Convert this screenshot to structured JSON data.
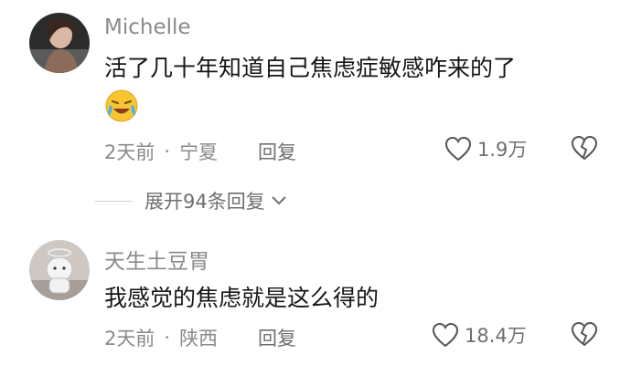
{
  "comments": [
    {
      "username": "Michelle",
      "text": "活了几十年知道自己焦虑症敏感咋来的了",
      "emoji": "crying-laughing-emoji",
      "time": "2天前",
      "location": "宁夏",
      "reply_label": "回复",
      "likes": "1.9万"
    },
    {
      "username": "天生土豆胃",
      "text": "我感觉的焦虑就是这么得的",
      "time": "2天前",
      "location": "陕西",
      "reply_label": "回复",
      "likes": "18.4万"
    }
  ],
  "thread": {
    "expand_label": "展开94条回复"
  },
  "colors": {
    "secondary_text": "#8a8a8a",
    "primary_text": "#161616",
    "background": "#ffffff"
  }
}
